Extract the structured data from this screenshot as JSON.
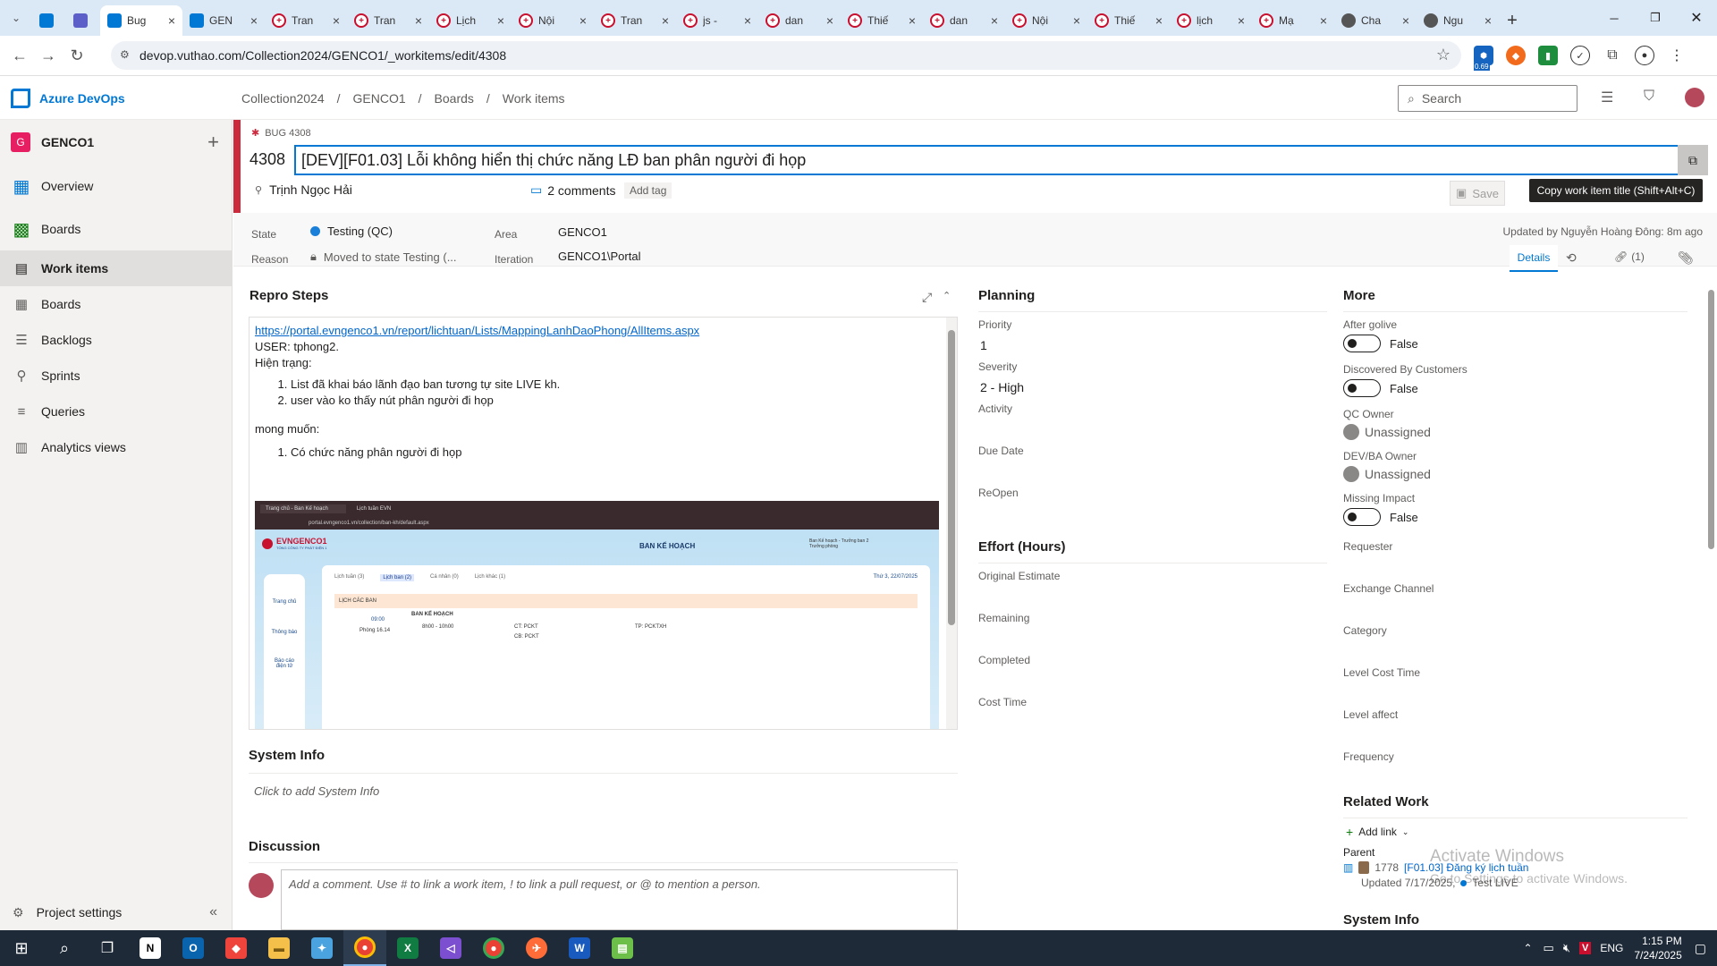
{
  "browser": {
    "tabs": [
      {
        "label": "",
        "icon": "ado-icon"
      },
      {
        "label": "",
        "icon": "teams-icon"
      },
      {
        "label": "Bug",
        "icon": "ado-icon",
        "active": true
      },
      {
        "label": "GEN",
        "icon": "ado-icon"
      },
      {
        "label": "Tran",
        "icon": "evn-icon"
      },
      {
        "label": "Tran",
        "icon": "evn-icon"
      },
      {
        "label": "Lịch",
        "icon": "evn-icon"
      },
      {
        "label": "Nội",
        "icon": "evn-icon"
      },
      {
        "label": "Tran",
        "icon": "evn-icon"
      },
      {
        "label": "js -",
        "icon": "evn-icon"
      },
      {
        "label": "dan",
        "icon": "evn-icon"
      },
      {
        "label": "Thiế",
        "icon": "evn-icon"
      },
      {
        "label": "dan",
        "icon": "evn-icon"
      },
      {
        "label": "Nội",
        "icon": "evn-icon"
      },
      {
        "label": "Thiế",
        "icon": "evn-icon"
      },
      {
        "label": "lịch",
        "icon": "evn-icon"
      },
      {
        "label": "Mạ",
        "icon": "evn-icon"
      },
      {
        "label": "Cha",
        "icon": "chat-icon"
      },
      {
        "label": "Ngu",
        "icon": "chat-icon"
      }
    ],
    "url": "devop.vuthao.com/Collection2024/GENCO1/_workitems/edit/4308",
    "ext_badge": "0.69"
  },
  "ado": {
    "brand": "Azure DevOps",
    "breadcrumb": [
      "Collection2024",
      "/",
      "GENCO1",
      "/",
      "Boards",
      "/",
      "Work items"
    ],
    "search_placeholder": "Search",
    "project_initial": "G",
    "project_name": "GENCO1",
    "nav": [
      {
        "label": "Overview",
        "icon": "overview-icon"
      },
      {
        "label": "Boards",
        "icon": "boards-hub-icon"
      },
      {
        "label": "Work items",
        "icon": "work-items-icon",
        "selected": true
      },
      {
        "label": "Boards",
        "icon": "boards-icon"
      },
      {
        "label": "Backlogs",
        "icon": "backlogs-icon"
      },
      {
        "label": "Sprints",
        "icon": "sprints-icon"
      },
      {
        "label": "Queries",
        "icon": "queries-icon"
      },
      {
        "label": "Analytics views",
        "icon": "analytics-icon"
      }
    ],
    "project_settings": "Project settings"
  },
  "workitem": {
    "type_label": "BUG 4308",
    "id": "4308",
    "title": "[DEV][F01.03] Lỗi không hiển thị chức năng LĐ ban phân người đi họp",
    "assignee": "Trịnh Ngọc Hải",
    "comments": "2 comments",
    "add_tag": "Add tag",
    "save": "Save",
    "tooltip": "Copy work item title (Shift+Alt+C)",
    "state_label": "State",
    "state_value": "Testing (QC)",
    "reason_label": "Reason",
    "reason_value": "Moved to state Testing (...",
    "area_label": "Area",
    "area_value": "GENCO1",
    "iteration_label": "Iteration",
    "iteration_value": "GENCO1\\Portal",
    "updated": "Updated by Nguyễn Hoàng Đông: 8m ago",
    "tabs": {
      "details": "Details",
      "links": "(1)"
    },
    "colors": {
      "state_dot": "#1a7fd9",
      "bug_bar": "#cc293d",
      "accent": "#0078d4"
    }
  },
  "repro": {
    "title": "Repro Steps",
    "link": "https://portal.evngenco1.vn/report/lichtuan/Lists/MappingLanhDaoPhong/AllItems.aspx",
    "user": "USER: tphong2.",
    "current": "Hiện trạng:",
    "list1": [
      "List đã khai báo lãnh đạo ban tương tự site LIVE kh.",
      "user vào ko thấy nút phân người đi họp"
    ],
    "wish": "mong muốn:",
    "list2": [
      "Có chức năng phân người đi họp"
    ],
    "shot": {
      "tab1": "Trang chủ - Ban Kế hoạch",
      "tab2": "Lịch tuần EVN",
      "url": "portal.evngenco1.vn/collection/ban-kh/default.aspx",
      "logo": "EVNGENCO1",
      "logo_sub": "TỔNG CÔNG TY PHÁT ĐIỆN 1",
      "dept": "BAN KẾ HOẠCH",
      "user": "Ban Kế hoạch - Trưởng ban 2",
      "role": "Trưởng phòng",
      "side": [
        "Trang chủ",
        "Thông báo",
        "Báo cáo điện tử"
      ],
      "filters": [
        "Lịch tuần (3)",
        "Lịch ban (2)",
        "Cá nhân (0)",
        "Lịch khác (1)"
      ],
      "date": "Thứ 3, 22/07/2025",
      "section": "LỊCH CÁC BAN",
      "time": "09:00",
      "room": "Phòng 16.14",
      "unit": "BAN KẾ HOẠCH",
      "slot": "8h00 - 10h00",
      "p1": "CT: PCKT",
      "p2": "CB: PCKT",
      "p3": "TP: PCKTXH"
    }
  },
  "sysinfo": {
    "title": "System Info",
    "placeholder": "Click to add System Info"
  },
  "discussion": {
    "title": "Discussion",
    "placeholder": "Add a comment. Use # to link a work item, ! to link a pull request, or @ to mention a person."
  },
  "planning": {
    "title": "Planning",
    "fields": [
      {
        "label": "Priority",
        "value": "1"
      },
      {
        "label": "Severity",
        "value": "2 - High"
      },
      {
        "label": "Activity",
        "value": ""
      },
      {
        "label": "Due Date",
        "value": ""
      },
      {
        "label": "ReOpen",
        "value": ""
      }
    ]
  },
  "effort": {
    "title": "Effort (Hours)",
    "fields": [
      "Original Estimate",
      "Remaining",
      "Completed",
      "Cost Time"
    ]
  },
  "more": {
    "title": "More",
    "after_golive": {
      "label": "After golive",
      "value": "False"
    },
    "discovered": {
      "label": "Discovered By Customers",
      "value": "False"
    },
    "qc_owner": {
      "label": "QC Owner",
      "value": "Unassigned"
    },
    "dev_owner": {
      "label": "DEV/BA Owner",
      "value": "Unassigned"
    },
    "missing": {
      "label": "Missing Impact",
      "value": "False"
    },
    "labels": [
      "Requester",
      "Exchange Channel",
      "Category",
      "Level Cost Time",
      "Level affect",
      "Frequency"
    ]
  },
  "related": {
    "title": "Related Work",
    "add_link": "Add link",
    "parent_label": "Parent",
    "parent_id": "1778",
    "parent_title": "[F01.03] Đăng ký lịch tuần",
    "parent_updated": "Updated 7/17/2025,",
    "parent_state": "Test LIVE",
    "sys2": "System Info"
  },
  "watermark": {
    "line1": "Activate Windows",
    "line2": "Go to Settings to activate Windows."
  },
  "taskbar": {
    "time": "1:15 PM",
    "date": "7/24/2025",
    "lang": "ENG"
  }
}
